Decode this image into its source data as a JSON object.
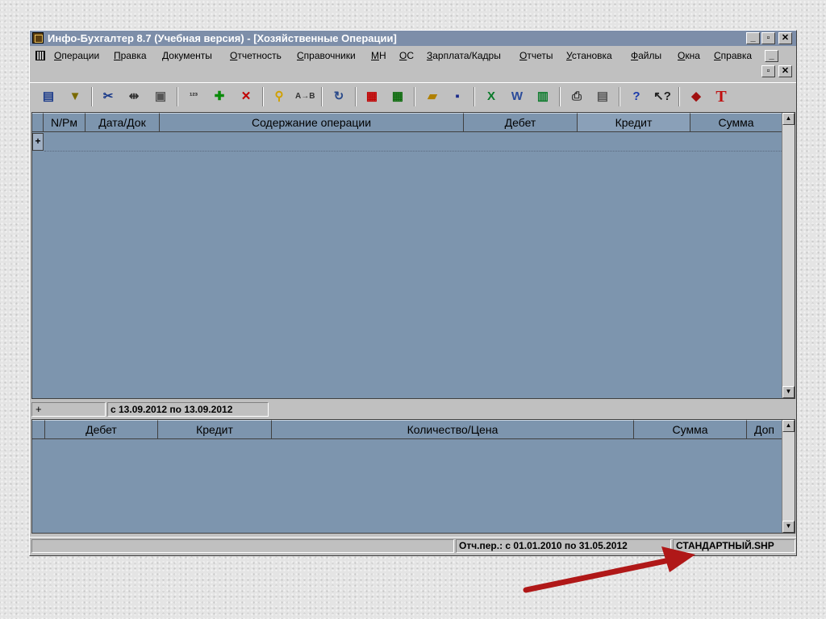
{
  "window": {
    "title": "Инфо-Бухгалтер 8.7 (Учебная версия) - [Хозяйственные Операции]"
  },
  "menu": [
    "Операции",
    "Правка",
    "Документы",
    "Отчетность",
    "Справочники",
    "МН",
    "ОС",
    "Зарплата/Кадры",
    "Отчеты",
    "Установка",
    "Файлы",
    "Окна",
    "Справка"
  ],
  "toolbar_icons": [
    "journal-icon",
    "filter-icon",
    "scissors-icon",
    "merge-icon",
    "paste-icon",
    "numbering-icon",
    "add-icon",
    "delete-icon",
    "search-icon",
    "replace-icon",
    "refresh-icon",
    "calendar-icon",
    "calculator-icon",
    "open-folder-icon",
    "save-icon",
    "excel-icon",
    "word-icon",
    "report-icon",
    "print-icon",
    "preview-icon",
    "help-icon",
    "context-help-icon",
    "app-logo-icon",
    "t-logo-icon"
  ],
  "operations_table": {
    "columns": [
      "N/Рм",
      "Дата/Док",
      "Содержание операции",
      "Дебет",
      "Кредит",
      "Сумма"
    ],
    "row_marker": "+"
  },
  "period_bar": {
    "marker": "+",
    "range": "с 13.09.2012 по 13.09.2012"
  },
  "entries_table": {
    "columns": [
      "Дебет",
      "Кредит",
      "Количество/Цена",
      "Сумма",
      "Доп"
    ]
  },
  "status": {
    "period": "Отч.пер.: с 01.01.2010 по 31.05.2012",
    "plan": "СТАНДАРТНЫЙ.SHP"
  },
  "colors": {
    "titlebar": "#7d8ea9",
    "grid_bg": "#7d95ae",
    "chrome": "#c0c0c0",
    "arrow": "#b01818"
  }
}
